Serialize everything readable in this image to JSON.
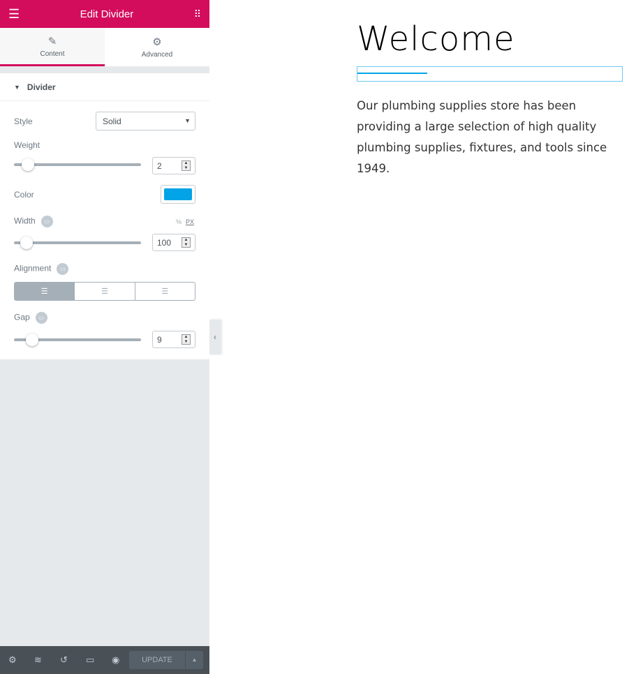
{
  "header": {
    "title": "Edit Divider"
  },
  "tabs": [
    {
      "label": "Content"
    },
    {
      "label": "Advanced"
    }
  ],
  "section": {
    "title": "Divider"
  },
  "controls": {
    "style": {
      "label": "Style",
      "value": "Solid"
    },
    "weight": {
      "label": "Weight",
      "value": "2",
      "fraction": 0.1
    },
    "color": {
      "label": "Color",
      "value": "#03a4e7"
    },
    "width": {
      "label": "Width",
      "value": "100",
      "unit_pct": "%",
      "unit_px": "PX",
      "fraction": 0.1
    },
    "alignment": {
      "label": "Alignment",
      "options": [
        "left",
        "center",
        "right"
      ],
      "selected": "left"
    },
    "gap": {
      "label": "Gap",
      "value": "9",
      "fraction": 0.15
    }
  },
  "footer": {
    "update": "UPDATE"
  },
  "preview": {
    "title": "Welcome",
    "text": "Our plumbing supplies store has been providing a large selection of high quality plumbing supplies, fixtures, and tools since 1949.",
    "accent": "#03a4e7"
  }
}
